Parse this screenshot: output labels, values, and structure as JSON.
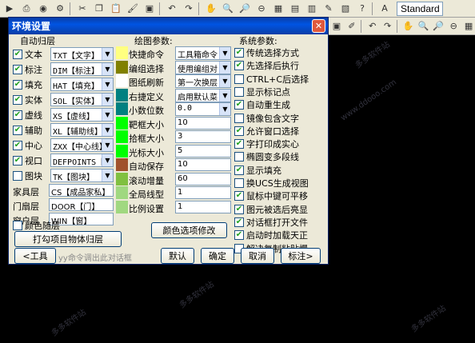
{
  "toolbar": {
    "standard_label": "Standard"
  },
  "watermarks": [
    "www.ddooo.com",
    "多多软件站",
    "多多软件站",
    "多多软件站",
    "多多软件站"
  ],
  "dialog": {
    "title": "环境设置",
    "close_label": "✕",
    "auto_layer": {
      "heading": "自动归层",
      "rows": [
        {
          "label": "文本",
          "checked": true,
          "value": "TXT【文字】"
        },
        {
          "label": "标注",
          "checked": true,
          "value": "DIM【标注】"
        },
        {
          "label": "填充",
          "checked": true,
          "value": "HAT【填充】"
        },
        {
          "label": "实体",
          "checked": true,
          "value": "SOL【实体】"
        },
        {
          "label": "虚线",
          "checked": true,
          "value": "XS【虚线】"
        },
        {
          "label": "辅助",
          "checked": true,
          "value": "XL【辅助线】"
        },
        {
          "label": "中心",
          "checked": true,
          "value": "ZXX【中心线】"
        },
        {
          "label": "视口",
          "checked": true,
          "value": "DEFPOINTS【"
        },
        {
          "label": "图块",
          "checked": false,
          "value": "TK【图块】"
        }
      ],
      "text_rows": [
        {
          "label": "家具层",
          "value": "CS【成品家私】"
        },
        {
          "label": "门扇层",
          "value": "DOOR【门】"
        },
        {
          "label": "窗户层",
          "value": "WIN【窗】"
        }
      ],
      "color_follow": {
        "label": "颜色随层",
        "checked": false
      },
      "button": "打勾项目物体归层"
    },
    "drawing": {
      "heading": "绘图参数:",
      "rows": [
        {
          "label": "快捷命令",
          "value": "工具箱命令",
          "kind": "combo",
          "color": "#ffff80"
        },
        {
          "label": "编组选择",
          "value": "使用编组对",
          "kind": "combo",
          "color": "#808000"
        },
        {
          "label": "图纸刷新",
          "value": "第一次换层",
          "kind": "combo",
          "color": "#ffffff"
        },
        {
          "label": "右捷定义",
          "value": "启用默认菜",
          "kind": "combo",
          "color": "#008080"
        },
        {
          "label": "小数位数",
          "value": "0.0",
          "kind": "combo",
          "color": "#008080"
        },
        {
          "label": "靶框大小",
          "value": "10",
          "kind": "field",
          "color": "#00ff00"
        },
        {
          "label": "拾框大小",
          "value": "3",
          "kind": "field",
          "color": "#00ff00"
        },
        {
          "label": "光标大小",
          "value": "5",
          "kind": "field",
          "color": "#00ff00"
        },
        {
          "label": "自动保存",
          "value": "10",
          "kind": "field",
          "color": "#a0522d"
        },
        {
          "label": "滚动增量",
          "value": "60",
          "kind": "field",
          "color": "#80c040"
        },
        {
          "label": "全局线型",
          "value": "1",
          "kind": "field",
          "color": "#a0d880"
        },
        {
          "label": "比例设置",
          "value": "1",
          "kind": "field",
          "color": "#a0d880"
        }
      ],
      "button": "颜色选项修改"
    },
    "system": {
      "heading": "系统参数:",
      "options": [
        {
          "label": "传统选择方式",
          "checked": true
        },
        {
          "label": "先选择后执行",
          "checked": true
        },
        {
          "label": "CTRL+C后选择",
          "checked": false
        },
        {
          "label": "显示标记点",
          "checked": false
        },
        {
          "label": "自动重生成",
          "checked": true
        },
        {
          "label": "镜像包含文字",
          "checked": false
        },
        {
          "label": "允许窗口选择",
          "checked": true
        },
        {
          "label": "字打印成实心",
          "checked": true
        },
        {
          "label": "椭圆变多段线",
          "checked": false
        },
        {
          "label": "显示填充",
          "checked": true
        },
        {
          "label": "换UCS生成视图",
          "checked": false
        },
        {
          "label": "鼠标中键可平移",
          "checked": true
        },
        {
          "label": "图元被选后亮显",
          "checked": true
        },
        {
          "label": "对话框打开文件",
          "checked": true
        },
        {
          "label": "启动时加载天正",
          "checked": true
        },
        {
          "label": "解决复制粘贴慢",
          "checked": false
        }
      ]
    },
    "footer": {
      "tools_button": "<工具",
      "hint": "yy命令调出此对话框",
      "default_button": "默认",
      "ok_button": "确定",
      "cancel_button": "取消",
      "dim_button": "标注>"
    }
  }
}
